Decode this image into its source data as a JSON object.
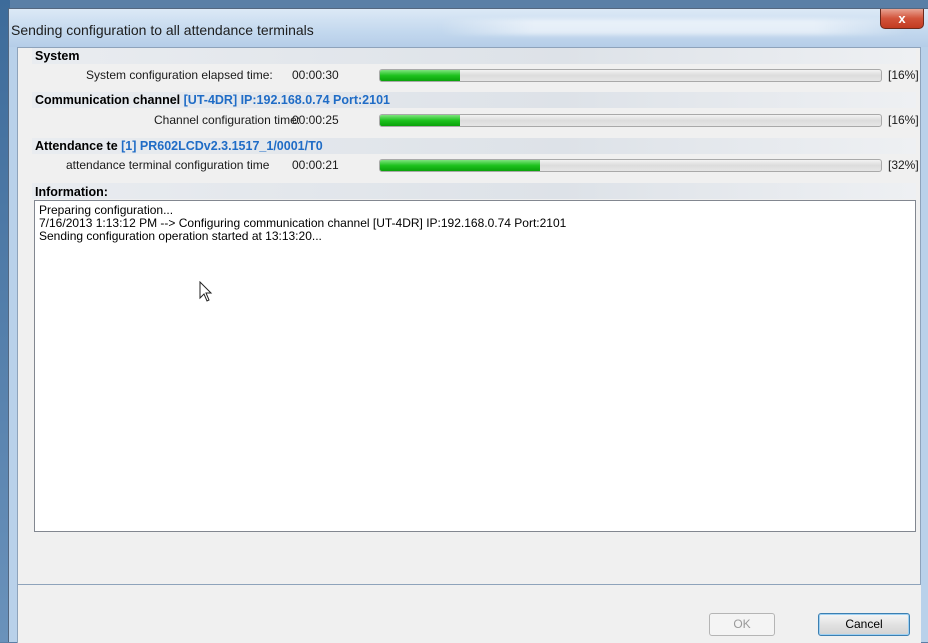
{
  "window": {
    "title": "Sending configuration to all attendance terminals",
    "close_glyph": "x"
  },
  "system": {
    "heading": "System",
    "label": "System configuration elapsed time:",
    "time": "00:00:30",
    "progress": 0.16,
    "percent_text": "[16%]"
  },
  "channel": {
    "heading_prefix": "Communication channel",
    "heading_detail": "[UT-4DR] IP:192.168.0.74  Port:2101",
    "label": "Channel configuration time:",
    "time": "00:00:25",
    "progress": 0.16,
    "percent_text": "[16%]"
  },
  "terminal": {
    "heading_prefix": "Attendance te",
    "heading_detail": "[1] PR602LCDv2.3.1517_1/0001/T0",
    "label": "attendance terminal configuration time",
    "time": "00:00:21",
    "progress": 0.32,
    "percent_text": "[32%]"
  },
  "information": {
    "heading": "Information:",
    "lines": [
      "Preparing configuration...",
      "7/16/2013 1:13:12 PM --> Configuring communication channel  [UT-4DR] IP:192.168.0.74  Port:2101",
      "Sending configuration operation started at 13:13:20..."
    ]
  },
  "buttons": {
    "ok": "OK",
    "cancel": "Cancel"
  },
  "colors": {
    "accent_blue": "#1f6cc6",
    "progress_green": "#1ec21e",
    "close_red": "#c23b21"
  },
  "icons": {
    "close": "close-icon",
    "cursor": "mouse-pointer-icon"
  }
}
